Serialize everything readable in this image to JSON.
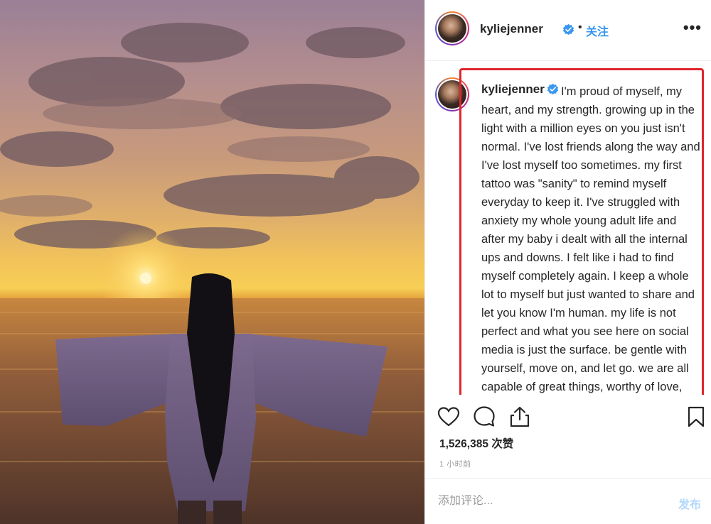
{
  "post": {
    "username": "kyliejenner",
    "follow_label": "关注",
    "dot": "•",
    "more": "•••",
    "caption_text": "I'm proud of myself, my heart, and my strength. growing up in the light with a million eyes on you just isn't normal. I've lost friends along the way and I've lost myself too sometimes. my first tattoo was \"sanity\" to remind myself everyday to keep it. I've struggled with anxiety my whole young adult life and after my baby i dealt with all the internal ups and downs. I felt like i had to find myself completely again. I keep a whole lot to myself but just wanted to share and let you know I'm human. my life is not perfect and what you see here on social media is just the surface. be gentle with yourself, move on, and let go. we are all capable of great things, worthy of love, and allowed to express ourselves. do more of what makes you happy and be",
    "likes": "1,526,385 次赞",
    "time": "1 小时前",
    "comment_placeholder": "添加评论...",
    "post_label": "发布"
  },
  "colors": {
    "verified_badge": "#3897f0",
    "follow": "#3897f0",
    "highlight_border": "#e0252d"
  },
  "icons": {
    "like": "heart-icon",
    "comment": "comment-icon",
    "share": "share-icon",
    "save": "bookmark-icon",
    "verified": "verified-badge-icon"
  }
}
